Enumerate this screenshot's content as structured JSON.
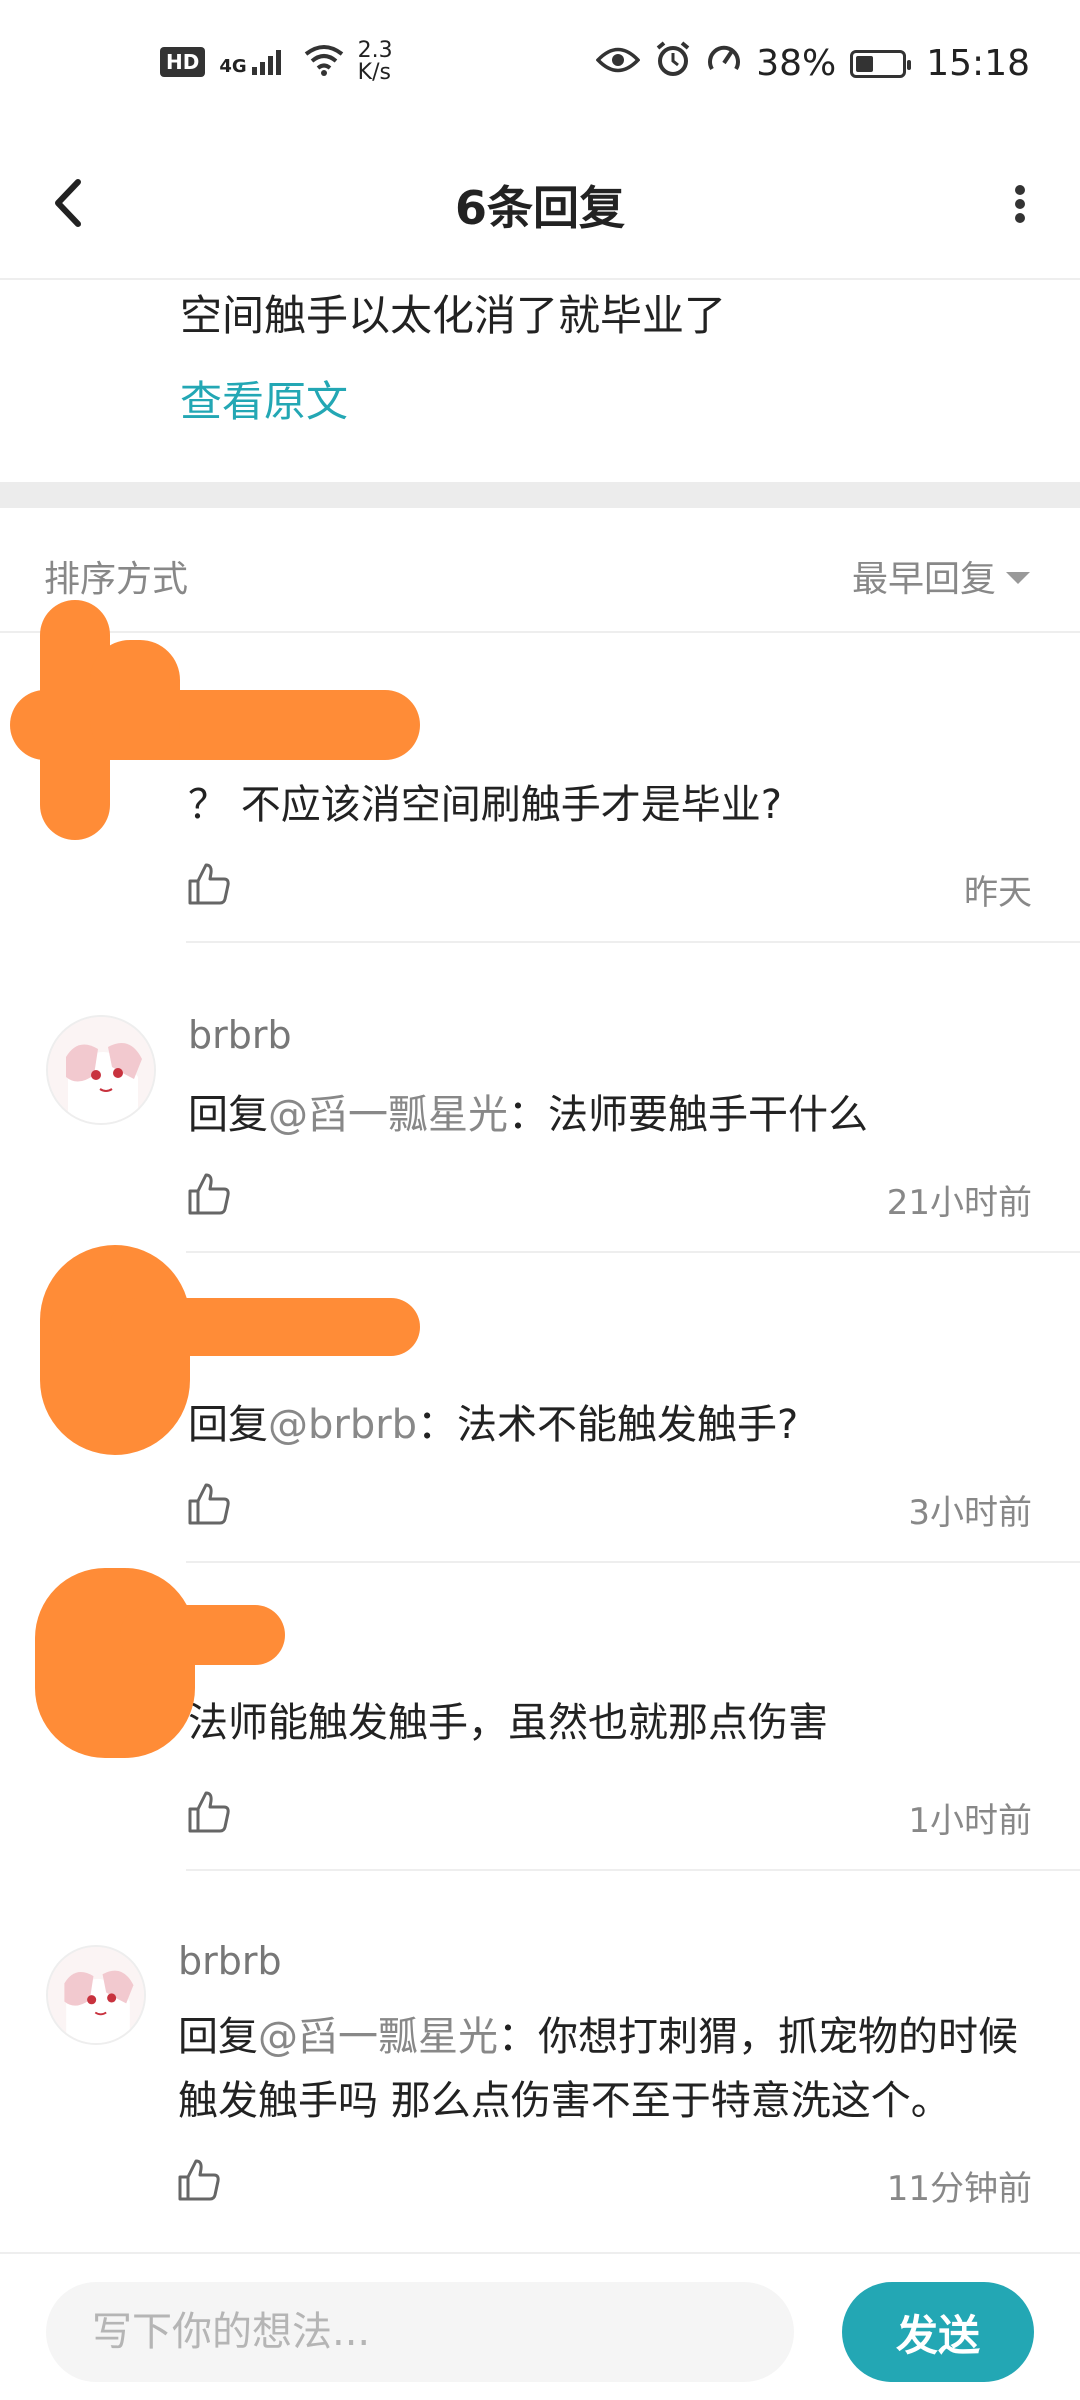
{
  "status_bar": {
    "hd": "HD",
    "network": "4G",
    "speed_value": "2.3",
    "speed_unit": "K/s",
    "battery_pct": "38%",
    "battery_level": 0.38,
    "time": "15:18"
  },
  "header": {
    "title": "6条回复"
  },
  "original": {
    "text": "空间触手以太化消了就毕业了",
    "view_link": "查看原文"
  },
  "sort": {
    "label": "排序方式",
    "value": "最早回复"
  },
  "comments": [
    {
      "author": "",
      "reply_prefix": "",
      "mention": "",
      "body": "？ 不应该消空间刷触手才是毕业?",
      "time": "昨天"
    },
    {
      "author": "brbrb",
      "reply_prefix": "回复",
      "mention": "@舀一瓢星光",
      "body": "：法师要触手干什么",
      "time": "21小时前"
    },
    {
      "author": "",
      "reply_prefix": "回复",
      "mention": "@brbrb",
      "body": "：法术不能触发触手?",
      "time": "3小时前"
    },
    {
      "author": "",
      "reply_prefix": "",
      "mention": "",
      "body": "法师能触发触手，虽然也就那点伤害",
      "time": "1小时前"
    },
    {
      "author": "brbrb",
      "reply_prefix": "回复",
      "mention": "@舀一瓢星光",
      "body": "：你想打刺猬，抓宠物的时候触发触手吗 那么点伤害不至于特意洗这个。",
      "time": "11分钟前"
    }
  ],
  "composer": {
    "placeholder": "写下你的想法...",
    "send_label": "发送"
  },
  "colors": {
    "accent": "#23a7b4",
    "redaction": "#ff8c37"
  }
}
